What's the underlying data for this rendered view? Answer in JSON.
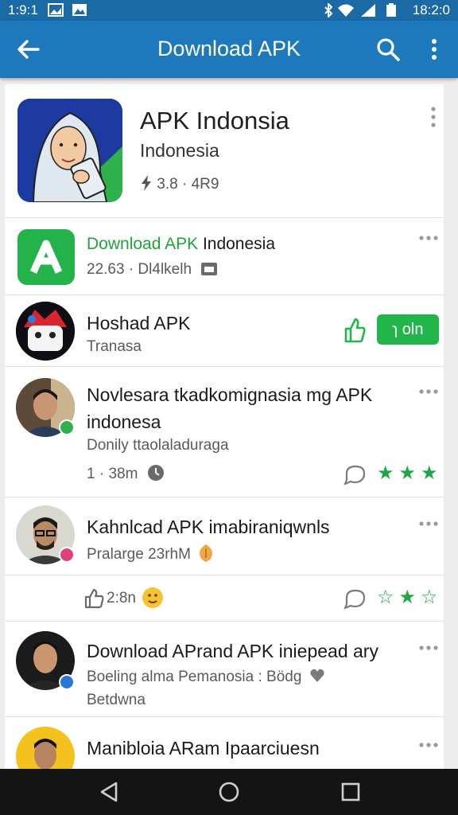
{
  "status_bar": {
    "time_left": "1:9:1",
    "time_right": "18:2:0"
  },
  "app_bar": {
    "title": "Download APK"
  },
  "hero": {
    "title": "APK Indonsia",
    "subtitle": "Indonesia",
    "meta": "3.8 · 4R9"
  },
  "items": [
    {
      "title_green": "Download APK",
      "title_rest": "Indonesia",
      "subtitle": "22.63 · Dl4lkelh"
    },
    {
      "title": "Hoshad APK",
      "subtitle": "Tranasa",
      "button": "ɿ oln"
    },
    {
      "title": "Novlesara tkadkomignasia mg APK indonesa",
      "subtitle": "Donily ttaolaladuraga",
      "meta": "1 · 38m"
    },
    {
      "title": "Kahnlcad APK imabiraniqwnls",
      "subtitle": "Pralarge 23rhM",
      "likes": "2:8n"
    },
    {
      "title": "Download APrand APK iniepead ary",
      "subtitle": "Boeling alma Pemanosia : Bödg",
      "subtitle2": "Betdwna"
    },
    {
      "title": "Manibloia ARam Ipaarciuesn"
    }
  ],
  "icons": {
    "status": [
      "image-icon",
      "mountain-icon",
      "bluetooth-icon",
      "wifi-icon",
      "signal-icon",
      "battery-icon"
    ],
    "app_bar": [
      "back-arrow-icon",
      "search-icon",
      "more-vert-icon"
    ],
    "nav": [
      "back-nav-icon",
      "home-nav-icon",
      "recents-nav-icon"
    ]
  },
  "colors": {
    "app_bar": "#1d79bb",
    "status_bar": "#1a6aa6",
    "accent_green": "#22b54a",
    "star_green": "#1ea84a"
  }
}
